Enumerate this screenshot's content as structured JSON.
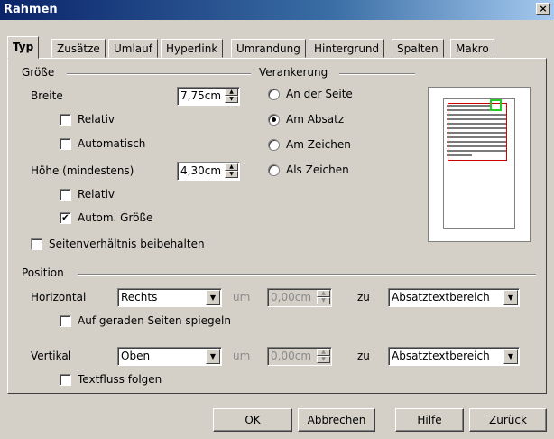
{
  "window": {
    "title": "Rahmen",
    "close": "×"
  },
  "tabs": [
    "Typ",
    "Zusätze",
    "Umlauf",
    "Hyperlink",
    "Umrandung",
    "Hintergrund",
    "Spalten",
    "Makro"
  ],
  "size": {
    "group": "Größe",
    "width_label": "Breite",
    "width_value": "7,75cm",
    "width_relative": "Relativ",
    "width_auto": "Automatisch",
    "height_label": "Höhe (mindestens)",
    "height_value": "4,30cm",
    "height_relative": "Relativ",
    "height_auto": "Autom. Größe",
    "keep_ratio": "Seitenverhältnis beibehalten",
    "checks": {
      "width_relative": false,
      "width_auto": false,
      "height_relative": false,
      "height_auto": true,
      "keep_ratio": false
    }
  },
  "anchor": {
    "group": "Verankerung",
    "options": [
      "An der Seite",
      "Am Absatz",
      "Am Zeichen",
      "Als Zeichen"
    ],
    "selected": "Am Absatz"
  },
  "position": {
    "group": "Position",
    "horizontal_label": "Horizontal",
    "horizontal_value": "Rechts",
    "h_by_label": "um",
    "h_by_value": "0,00cm",
    "h_to_label": "zu",
    "h_to_value": "Absatztextbereich",
    "mirror": "Auf geraden Seiten spiegeln",
    "vertical_label": "Vertikal",
    "vertical_value": "Oben",
    "v_by_label": "um",
    "v_by_value": "0,00cm",
    "v_to_label": "zu",
    "v_to_value": "Absatztextbereich",
    "follow": "Textfluss folgen",
    "checks": {
      "mirror": false,
      "follow": false
    }
  },
  "buttons": {
    "ok": "OK",
    "cancel": "Abbrechen",
    "help": "Hilfe",
    "back": "Zurück"
  },
  "icons": {
    "check": "✔",
    "spin_up": "▲",
    "spin_down": "▼",
    "dropdown": "▼"
  }
}
